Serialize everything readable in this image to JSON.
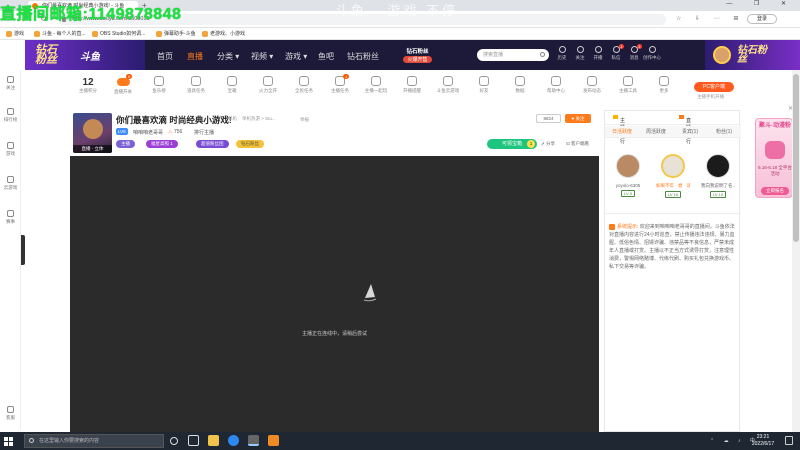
{
  "browser": {
    "tab_title": "你们最喜欢滴 时尚经典小游戏! - 斗鱼",
    "url": "https://www.douyu.com/8500016",
    "login_label": "登录",
    "window_controls": "— ❐ ✕",
    "toolbar_icons": "☆ ⇩ ⋯ ⊞"
  },
  "bookmarks": [
    {
      "label": "游戏"
    },
    {
      "label": "斗鱼 - 每个人的直..."
    },
    {
      "label": "OBS Studio如何调..."
    },
    {
      "label": "弹幕助手-斗鱼"
    },
    {
      "label": "老游戏、小游戏"
    }
  ],
  "overlay_text": "直播间邮箱:1149878848",
  "watermark_text": "斗鱼 · 游戏 不停",
  "header": {
    "logo_text": "钻石粉丝",
    "logo_sub": "斗鱼",
    "nav": [
      {
        "label": "首页"
      },
      {
        "label": "直播"
      },
      {
        "label": "分类 ▾"
      },
      {
        "label": "视频 ▾"
      },
      {
        "label": "游戏 ▾"
      },
      {
        "label": "鱼吧"
      },
      {
        "label": "钻石粉丝"
      }
    ],
    "promo_title": "钻石粉丝",
    "promo_badge": "火爆开售",
    "search_placeholder": "搜索直播",
    "icons": [
      {
        "label": "历史",
        "badge": ""
      },
      {
        "label": "关注",
        "badge": ""
      },
      {
        "label": "开播",
        "badge": ""
      },
      {
        "label": "私信",
        "badge": "1"
      },
      {
        "label": "消息",
        "badge": "1"
      },
      {
        "label": "创作中心",
        "badge": ""
      }
    ],
    "right_promo": "钻石粉丝"
  },
  "left_sidebar": [
    {
      "label": "关注"
    },
    {
      "label": "排行榜"
    },
    {
      "label": "游戏"
    },
    {
      "label": "云游戏"
    },
    {
      "label": "赛事"
    },
    {
      "label": "客服"
    }
  ],
  "icon_bar": {
    "first_value": "12",
    "first_label": "主播积分",
    "items": [
      {
        "label": "直播开关",
        "badge": "6"
      },
      {
        "label": "鱼乐榜",
        "badge": ""
      },
      {
        "label": "道具任务",
        "badge": ""
      },
      {
        "label": "宝箱",
        "badge": ""
      },
      {
        "label": "火力全开",
        "badge": ""
      },
      {
        "label": "全民任务",
        "badge": ""
      },
      {
        "label": "主播任务",
        "badge": "1"
      },
      {
        "label": "主播一起玩",
        "badge": ""
      },
      {
        "label": "开播提醒",
        "badge": ""
      },
      {
        "label": "斗鱼云游戏",
        "badge": ""
      },
      {
        "label": "好友",
        "badge": ""
      },
      {
        "label": "数据",
        "badge": ""
      },
      {
        "label": "帮助中心",
        "badge": ""
      },
      {
        "label": "发布动态",
        "badge": ""
      },
      {
        "label": "主播工具",
        "badge": ""
      },
      {
        "label": "更多",
        "badge": ""
      }
    ],
    "pc_client_label": "PC客户端",
    "mobile_label": "主播手机开播"
  },
  "room": {
    "cover_label": "直播 · 立体",
    "title": "你们最喜欢滴 时尚经典小游戏!",
    "tag1": "单机",
    "tag2": "单机热游 > Stu...",
    "report": "举报",
    "level": "LV8",
    "streamer": "咱咱咱老哥哥",
    "hot": "756",
    "rank_link": "排行主播",
    "pills": [
      {
        "label": "主播",
        "color": "#7b61d6"
      },
      {
        "label": "福星高照 1",
        "color": "#9b3fd6"
      },
      {
        "label": "超值粉丝团",
        "color": "#7a4bd6"
      },
      {
        "label": "钻石粉丝",
        "color": "#f4c13a"
      }
    ],
    "follow_count": "8824",
    "follow_label": "关注",
    "gift_label": "可领宝箱",
    "gift_count": "1",
    "share_label": "分享",
    "download_label": "客户端看"
  },
  "player": {
    "loading_text": "主播正在连线中，请稍后尝试"
  },
  "right_panel": {
    "top_left": "主播排行",
    "top_right": "直播排行",
    "tabs": [
      {
        "label": "日活跃度"
      },
      {
        "label": "周活跃度"
      },
      {
        "label": "贵宾(1)"
      },
      {
        "label": "粉丝(1)"
      }
    ],
    "rank": [
      {
        "name": "yoyolo-6305",
        "level": "LV 5"
      },
      {
        "name": "如果不年 · 想 · 读...",
        "level": "LV 16"
      },
      {
        "name": "我向我说明了名..",
        "level": "LV 10"
      }
    ],
    "sys_tag": "系统提示:",
    "sys_msg": "欢迎来到咱咱咱老哥哥的直播间，斗鱼依法对直播内容进行24小时巡查，禁止传播违法违规、暴力血腥、低俗色情、招嫖诈骗、违禁品等不良信息，严禁未成年人直播或打赏。主播以不正当方式诱导打赏，注意理性消费，警惕网络赌博、代练代刷、购买礼包兑换游戏币、私下交易等诈骗。"
  },
  "ad": {
    "title": "聚斗·动漫粉",
    "line": "6.16-6.18 全平台活动",
    "cta": "立即报名"
  },
  "taskbar": {
    "search_placeholder": "在这里输入你要搜索的内容",
    "time": "23:21",
    "date": "2022/6/17",
    "tray": "⌃ ☁ ♪ 中"
  }
}
